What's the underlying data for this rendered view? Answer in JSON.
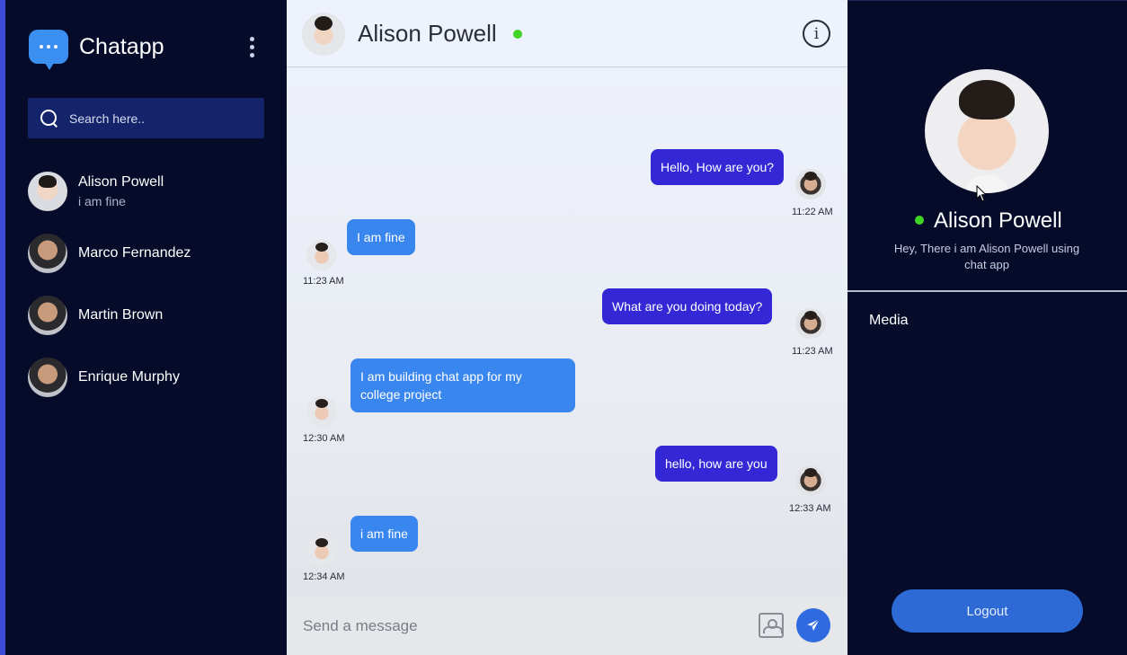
{
  "app": {
    "name": "Chatapp"
  },
  "search": {
    "placeholder": "Search here.."
  },
  "contacts": [
    {
      "name": "Alison Powell",
      "last_message": "i am fine"
    },
    {
      "name": "Marco Fernandez",
      "last_message": ""
    },
    {
      "name": "Martin Brown",
      "last_message": ""
    },
    {
      "name": "Enrique Murphy",
      "last_message": ""
    }
  ],
  "chat": {
    "contact_name": "Alison Powell",
    "status": "online",
    "messages": [
      {
        "direction": "outgoing",
        "text": "Hello, How are you?",
        "time": "11:22 AM"
      },
      {
        "direction": "incoming",
        "text": "I am fine",
        "time": "11:23 AM"
      },
      {
        "direction": "outgoing",
        "text": "What are you doing today?",
        "time": "11:23 AM"
      },
      {
        "direction": "incoming",
        "text_line1": "I am building chat app for my",
        "text_line2": "college project",
        "time": "12:30 AM"
      },
      {
        "direction": "outgoing",
        "text": "hello, how are you",
        "time": "12:33 AM"
      },
      {
        "direction": "incoming",
        "text": "i am fine",
        "time": "12:34 AM"
      }
    ],
    "composer_placeholder": "Send a message"
  },
  "profile": {
    "name": "Alison Powell",
    "about": "Hey, There i am Alison Powell using chat app",
    "media_label": "Media",
    "logout_label": "Logout"
  },
  "icons": {
    "brand": "chat-bubble-icon",
    "menu": "kebab-menu-icon",
    "search": "search-icon",
    "info": "info-icon",
    "image": "image-icon",
    "send": "send-icon"
  },
  "colors": {
    "sidebar_bg": "#060b2a",
    "search_bg": "#13246a",
    "outgoing_bubble": "#3327d6",
    "incoming_bubble": "#3a86ef",
    "online": "#3fd524",
    "logout": "#2e6ad6"
  }
}
